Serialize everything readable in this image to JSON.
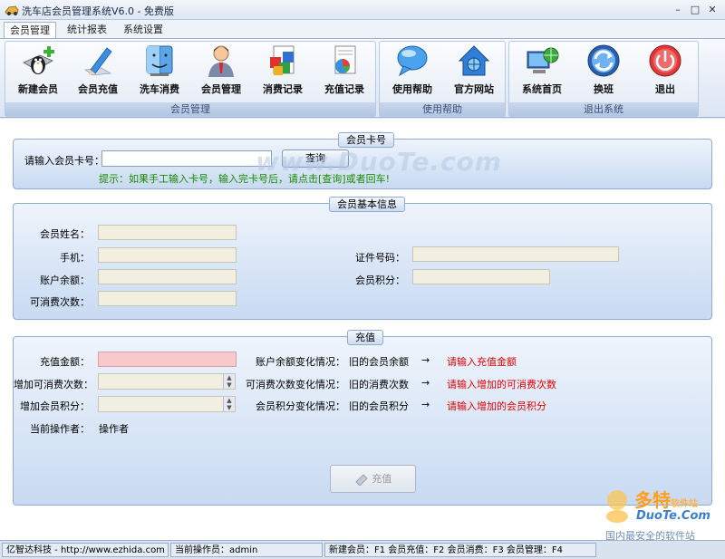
{
  "window": {
    "title": "洗车店会员管理系统V6.0 - 免费版",
    "controls": [
      "minimize",
      "maximize",
      "close"
    ]
  },
  "tabs": [
    {
      "label": "会员管理",
      "active": true
    },
    {
      "label": "统计报表",
      "active": false
    },
    {
      "label": "系统设置",
      "active": false
    }
  ],
  "ribbon": {
    "groups": [
      {
        "label": "会员管理"
      },
      {
        "label": "使用帮助"
      },
      {
        "label": "退出系统"
      }
    ],
    "buttons": [
      {
        "label": "新建会员",
        "icon": "penguin-monitor-icon"
      },
      {
        "label": "会员充值",
        "icon": "pencil-icon"
      },
      {
        "label": "洗车消费",
        "icon": "finder-face-icon"
      },
      {
        "label": "会员管理",
        "icon": "person-icon"
      },
      {
        "label": "消费记录",
        "icon": "blocks-icon"
      },
      {
        "label": "充值记录",
        "icon": "pie-document-icon"
      },
      {
        "label": "使用帮助",
        "icon": "speech-bubble-icon"
      },
      {
        "label": "官方网站",
        "icon": "house-icon"
      },
      {
        "label": "系统首页",
        "icon": "computer-globe-icon"
      },
      {
        "label": "换班",
        "icon": "refresh-icon"
      },
      {
        "label": "退出",
        "icon": "power-icon"
      }
    ]
  },
  "card_panel": {
    "title": "会员卡号",
    "label": "请输入会员卡号：",
    "value": "",
    "query_button": "查询",
    "hint": "提示：如果手工输入卡号，输入完卡号后，请点击[查询]或者回车!"
  },
  "info_panel": {
    "title": "会员基本信息",
    "name_label": "会员姓名：",
    "phone_label": "手机：",
    "balance_label": "账户余额：",
    "times_label": "可消费次数：",
    "id_label": "证件号码：",
    "points_label": "会员积分："
  },
  "recharge_panel": {
    "title": "充值",
    "amount_label": "充值金额：",
    "add_times_label": "增加可消费次数：",
    "add_points_label": "增加会员积分：",
    "operator_label": "当前操作者：",
    "operator_value": "操作者",
    "balance_change_label": "账户余额变化情况：",
    "balance_old": "旧的会员余额",
    "times_change_label": "可消费次数变化情况：",
    "times_old": "旧的消费次数",
    "points_change_label": "会员积分变化情况：",
    "points_old": "旧的会员积分",
    "arrow": "→",
    "balance_prompt": "请输入充值金额",
    "times_prompt": "请输入增加的可消费次数",
    "points_prompt": "请输入增加的会员积分",
    "submit_button": "充值",
    "prompt_color": "#e00000"
  },
  "watermark": "www.DuoTe.com",
  "corner_logo": {
    "line1": "多特",
    "line1_suffix": "软件站",
    "line2": "DuoTe.Com",
    "line3": "国内最安全的软件站"
  },
  "statusbar": {
    "company": "亿智达科技 - http://www.ezhida.com",
    "operator": "当前操作员：admin",
    "shortcuts": "新建会员：F1    会员充值：F2    会员消费：F3    会员管理：F4"
  }
}
